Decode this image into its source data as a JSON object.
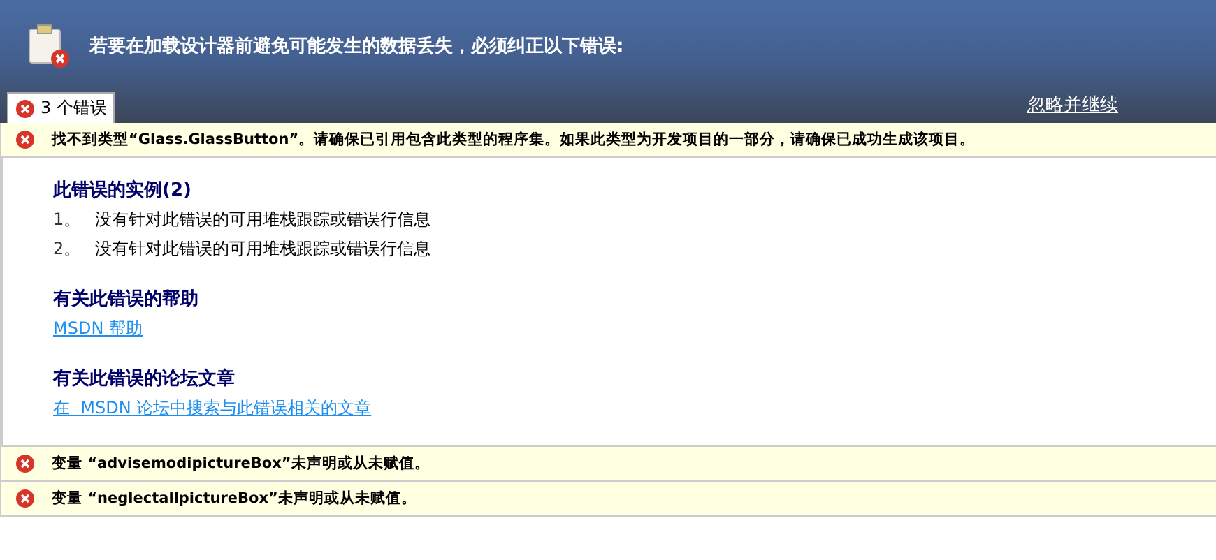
{
  "header": {
    "title": "若要在加载设计器前避免可能发生的数据丢失，必须纠正以下错误:"
  },
  "tabs": [
    {
      "label": "3 个错误",
      "selected": true
    }
  ],
  "ignore_link": "忽略并继续",
  "errors": [
    {
      "message": "找不到类型“Glass.GlassButton”。请确保已引用包含此类型的程序集。如果此类型为开发项目的一部分，请确保已成功生成该项目。",
      "details": {
        "instances_heading": "此错误的实例(2)",
        "instances": [
          {
            "number": "1。",
            "text": "没有针对此错误的可用堆栈跟踪或错误行信息"
          },
          {
            "number": "2。",
            "text": "没有针对此错误的可用堆栈跟踪或错误行信息"
          }
        ],
        "help_heading": "有关此错误的帮助",
        "help_link": "MSDN 帮助",
        "forum_heading": "有关此错误的论坛文章",
        "forum_link": "在  MSDN 论坛中搜索与此错误相关的文章"
      }
    },
    {
      "message": "变量 “advisemodipictureBox”未声明或从未赋值。"
    },
    {
      "message": "变量 “neglectallpictureBox”未声明或从未赋值。"
    }
  ]
}
